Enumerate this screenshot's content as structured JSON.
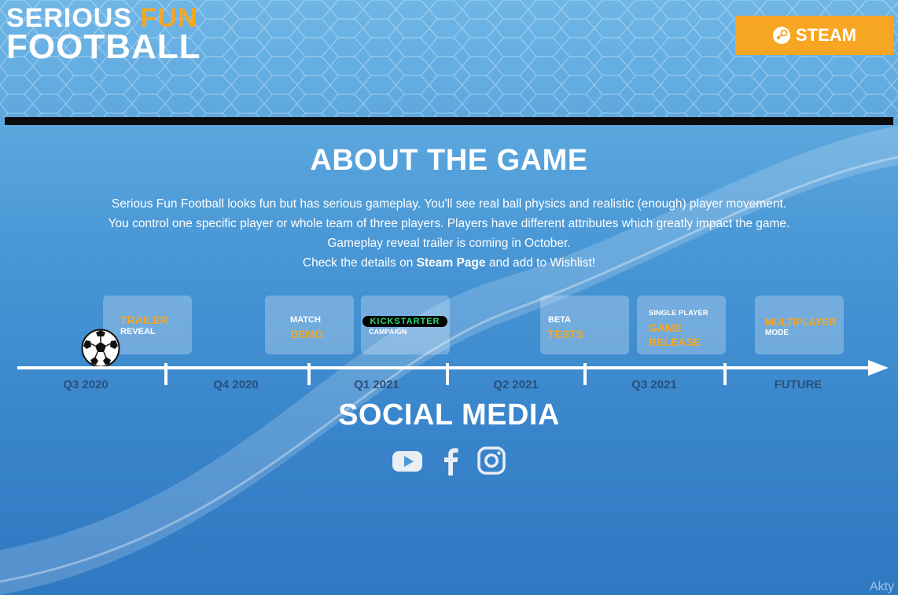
{
  "logo": {
    "word1": "SERIOUS",
    "word2": "FUN",
    "word3": "FOOTBALL"
  },
  "header": {
    "steam_label": "STEAM"
  },
  "about": {
    "title": "ABOUT THE GAME",
    "line1": "Serious Fun Football looks fun but has serious gameplay. You'll see real ball physics and realistic (enough) player movement.",
    "line2": "You control one specific player or whole team of three players. Players have different attributes which greatly impact the game.",
    "line3": "Gameplay reveal trailer is coming in October.",
    "line4_pre": "Check the details on ",
    "line4_link": "Steam Page",
    "line4_post": " and add to Wishlist!"
  },
  "timeline": {
    "milestones": [
      {
        "big": "TRAILER",
        "small": "REVEAL"
      },
      {
        "small": "MATCH",
        "big": "DEMO"
      },
      {
        "badge": "KICKSTARTER",
        "small": "CAMPAIGN"
      },
      {
        "small": "BETA",
        "big": "TESTS"
      },
      {
        "small": "SINGLE PLAYER",
        "big": "GAME RELEASE"
      },
      {
        "big": "MULTIPLAYER",
        "small": "MODE"
      }
    ],
    "quarters": [
      "Q3 2020",
      "Q4 2020",
      "Q1 2021",
      "Q2 2021",
      "Q3 2021",
      "FUTURE"
    ]
  },
  "social": {
    "title": "SOCIAL MEDIA",
    "icons": [
      "youtube-icon",
      "facebook-icon",
      "instagram-icon"
    ]
  },
  "watermark": "Akty",
  "colors": {
    "accent": "#f6a623",
    "divider": "#0b0b0b",
    "kickstarter": "#2bde73"
  }
}
